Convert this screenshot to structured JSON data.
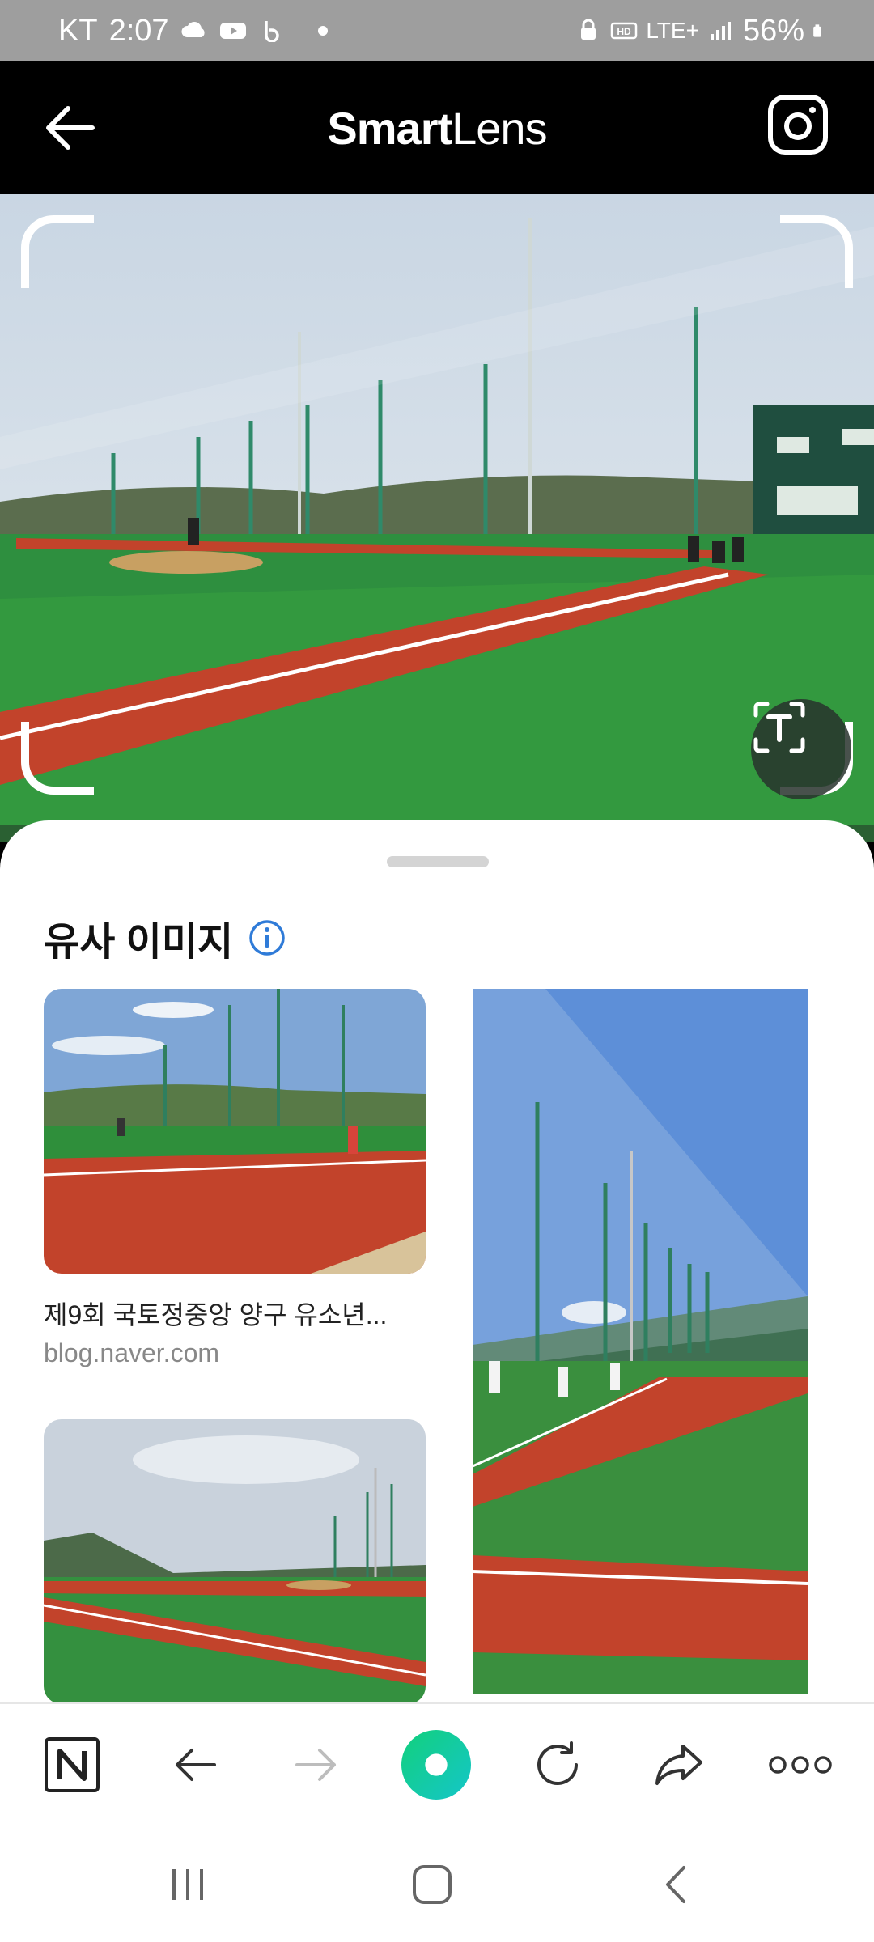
{
  "status_bar": {
    "carrier": "KT",
    "time": "2:07",
    "network": "LTE+",
    "battery": "56%"
  },
  "app_bar": {
    "title_bold": "Smart",
    "title_light": "Lens"
  },
  "similar_images": {
    "title": "유사 이미지",
    "items": [
      {
        "caption": "제9회 국토정중앙 양구 유소년...",
        "source": "blog.naver.com"
      }
    ]
  },
  "icons": {
    "back": "back-arrow-icon",
    "camera": "camera-icon",
    "text_scan": "text-scan-icon",
    "info": "info-icon",
    "toolbar": [
      "naver-n-icon",
      "back-icon",
      "forward-icon",
      "green-dot-icon",
      "refresh-icon",
      "share-icon",
      "more-icon"
    ],
    "nav": [
      "recents-icon",
      "home-icon",
      "nav-back-icon"
    ]
  },
  "colors": {
    "accent_green": "#1ec800",
    "info_blue": "#2f7bd8"
  }
}
